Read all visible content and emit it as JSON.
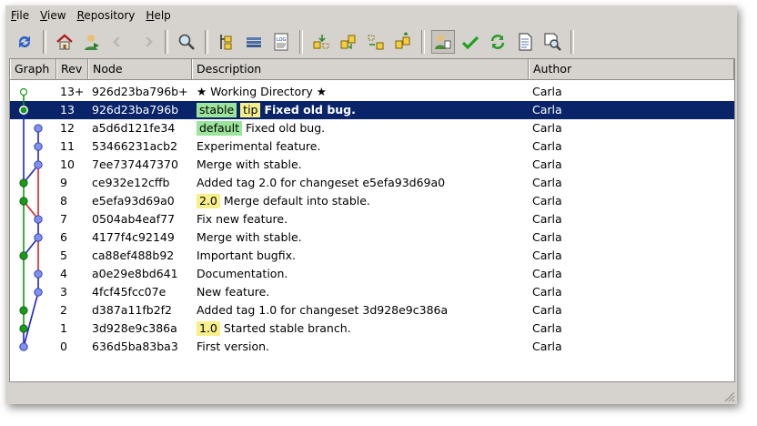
{
  "menu": [
    {
      "label": "File",
      "key": "F",
      "rest": "ile"
    },
    {
      "label": "View",
      "key": "V",
      "rest": "iew"
    },
    {
      "label": "Repository",
      "key": "R",
      "rest": "epository"
    },
    {
      "label": "Help",
      "key": "H",
      "rest": "elp"
    }
  ],
  "toolbar": [
    {
      "icon": "refresh-icon"
    },
    {
      "sep": true
    },
    {
      "icon": "home-icon"
    },
    {
      "icon": "goto-icon"
    },
    {
      "icon": "back-arrow-icon",
      "disabled": true
    },
    {
      "icon": "forward-arrow-icon",
      "disabled": true
    },
    {
      "sep": true
    },
    {
      "icon": "search-icon"
    },
    {
      "sep": true
    },
    {
      "icon": "branch-filter-icon"
    },
    {
      "icon": "stack-icon"
    },
    {
      "icon": "log-icon"
    },
    {
      "sep": true
    },
    {
      "icon": "incoming-icon"
    },
    {
      "icon": "pull-icon"
    },
    {
      "icon": "outgoing-icon"
    },
    {
      "icon": "push-icon"
    },
    {
      "sep": true
    },
    {
      "icon": "user-filter-icon",
      "active": true
    },
    {
      "icon": "checkmark-icon"
    },
    {
      "icon": "sync-icon"
    },
    {
      "icon": "document-icon"
    },
    {
      "icon": "zoom-document-icon"
    },
    {
      "sep": true
    }
  ],
  "columns": [
    "Graph",
    "Rev",
    "Node",
    "Description",
    "Author"
  ],
  "rows": [
    {
      "rev": "13+",
      "node": "926d23ba796b+",
      "desc": "★ Working Directory ★",
      "tags": [],
      "author": "Carla"
    },
    {
      "rev": "13",
      "node": "926d23ba796b",
      "desc": "Fixed old bug.",
      "tags": [
        {
          "t": "stable",
          "k": "branch"
        },
        {
          "t": "tip",
          "k": "tip"
        }
      ],
      "author": "Carla",
      "selected": true,
      "bold": true
    },
    {
      "rev": "12",
      "node": "a5d6d121fe34",
      "desc": "Fixed old bug.",
      "tags": [
        {
          "t": "default",
          "k": "branch"
        }
      ],
      "author": "Carla"
    },
    {
      "rev": "11",
      "node": "53466231acb2",
      "desc": "Experimental feature.",
      "tags": [],
      "author": "Carla"
    },
    {
      "rev": "10",
      "node": "7ee737447370",
      "desc": "Merge with stable.",
      "tags": [],
      "author": "Carla"
    },
    {
      "rev": "9",
      "node": "ce932e12cffb",
      "desc": "Added tag 2.0 for changeset e5efa93d69a0",
      "tags": [],
      "author": "Carla"
    },
    {
      "rev": "8",
      "node": "e5efa93d69a0",
      "desc": "Merge default into stable.",
      "tags": [
        {
          "t": "2.0",
          "k": "ver"
        }
      ],
      "author": "Carla"
    },
    {
      "rev": "7",
      "node": "0504ab4eaf77",
      "desc": "Fix new feature.",
      "tags": [],
      "author": "Carla"
    },
    {
      "rev": "6",
      "node": "4177f4c92149",
      "desc": "Merge with stable.",
      "tags": [],
      "author": "Carla"
    },
    {
      "rev": "5",
      "node": "ca88ef488b92",
      "desc": "Important bugfix.",
      "tags": [],
      "author": "Carla"
    },
    {
      "rev": "4",
      "node": "a0e29e8bd641",
      "desc": "Documentation.",
      "tags": [],
      "author": "Carla"
    },
    {
      "rev": "3",
      "node": "4fcf45fcc07e",
      "desc": "New feature.",
      "tags": [],
      "author": "Carla"
    },
    {
      "rev": "2",
      "node": "d387a11fb2f2",
      "desc": "Added tag 1.0 for changeset 3d928e9c386a",
      "tags": [],
      "author": "Carla"
    },
    {
      "rev": "1",
      "node": "3d928e9c386a",
      "desc": "Started stable branch.",
      "tags": [
        {
          "t": "1.0",
          "k": "ver"
        }
      ],
      "author": "Carla"
    },
    {
      "rev": "0",
      "node": "636d5ba83ba3",
      "desc": "First version.",
      "tags": [],
      "author": "Carla"
    }
  ],
  "graph": {
    "lane_colors": [
      "#1a9a1a",
      "#3f5ae8"
    ],
    "edge_colors": {
      "blue": "#2222cc",
      "red": "#dd2222",
      "green": "#119911"
    },
    "nodes": [
      {
        "row": 0,
        "lane": 0,
        "color": "open"
      },
      {
        "row": 1,
        "lane": 0,
        "color": "green"
      },
      {
        "row": 2,
        "lane": 1,
        "color": "blue"
      },
      {
        "row": 3,
        "lane": 1,
        "color": "blue"
      },
      {
        "row": 4,
        "lane": 1,
        "color": "blue"
      },
      {
        "row": 5,
        "lane": 0,
        "color": "green"
      },
      {
        "row": 6,
        "lane": 0,
        "color": "green"
      },
      {
        "row": 7,
        "lane": 1,
        "color": "blue"
      },
      {
        "row": 8,
        "lane": 1,
        "color": "blue"
      },
      {
        "row": 9,
        "lane": 0,
        "color": "green"
      },
      {
        "row": 10,
        "lane": 1,
        "color": "blue"
      },
      {
        "row": 11,
        "lane": 1,
        "color": "blue"
      },
      {
        "row": 12,
        "lane": 0,
        "color": "green"
      },
      {
        "row": 13,
        "lane": 0,
        "color": "green"
      },
      {
        "row": 14,
        "lane": 0,
        "color": "blue"
      }
    ],
    "edges": [
      {
        "from": [
          0,
          0
        ],
        "to": [
          1,
          0
        ],
        "c": "green"
      },
      {
        "from": [
          1,
          0
        ],
        "to": [
          5,
          0
        ],
        "c": "blue"
      },
      {
        "from": [
          2,
          1
        ],
        "to": [
          3,
          1
        ],
        "c": "blue"
      },
      {
        "from": [
          3,
          1
        ],
        "to": [
          4,
          1
        ],
        "c": "blue"
      },
      {
        "from": [
          4,
          1
        ],
        "to": [
          5,
          0
        ],
        "c": "blue"
      },
      {
        "from": [
          4,
          1
        ],
        "to": [
          7,
          1
        ],
        "c": "red"
      },
      {
        "from": [
          5,
          0
        ],
        "to": [
          6,
          0
        ],
        "c": "green"
      },
      {
        "from": [
          6,
          0
        ],
        "to": [
          9,
          0
        ],
        "c": "green"
      },
      {
        "from": [
          6,
          0
        ],
        "to": [
          7,
          1
        ],
        "c": "red"
      },
      {
        "from": [
          7,
          1
        ],
        "to": [
          8,
          1
        ],
        "c": "blue"
      },
      {
        "from": [
          8,
          1
        ],
        "to": [
          9,
          0
        ],
        "c": "blue"
      },
      {
        "from": [
          8,
          1
        ],
        "to": [
          10,
          1
        ],
        "c": "red"
      },
      {
        "from": [
          9,
          0
        ],
        "to": [
          12,
          0
        ],
        "c": "green"
      },
      {
        "from": [
          10,
          1
        ],
        "to": [
          11,
          1
        ],
        "c": "blue"
      },
      {
        "from": [
          11,
          1
        ],
        "to": [
          14,
          0
        ],
        "c": "blue"
      },
      {
        "from": [
          12,
          0
        ],
        "to": [
          13,
          0
        ],
        "c": "green"
      },
      {
        "from": [
          13,
          0
        ],
        "to": [
          14,
          0
        ],
        "c": "blue"
      }
    ]
  }
}
